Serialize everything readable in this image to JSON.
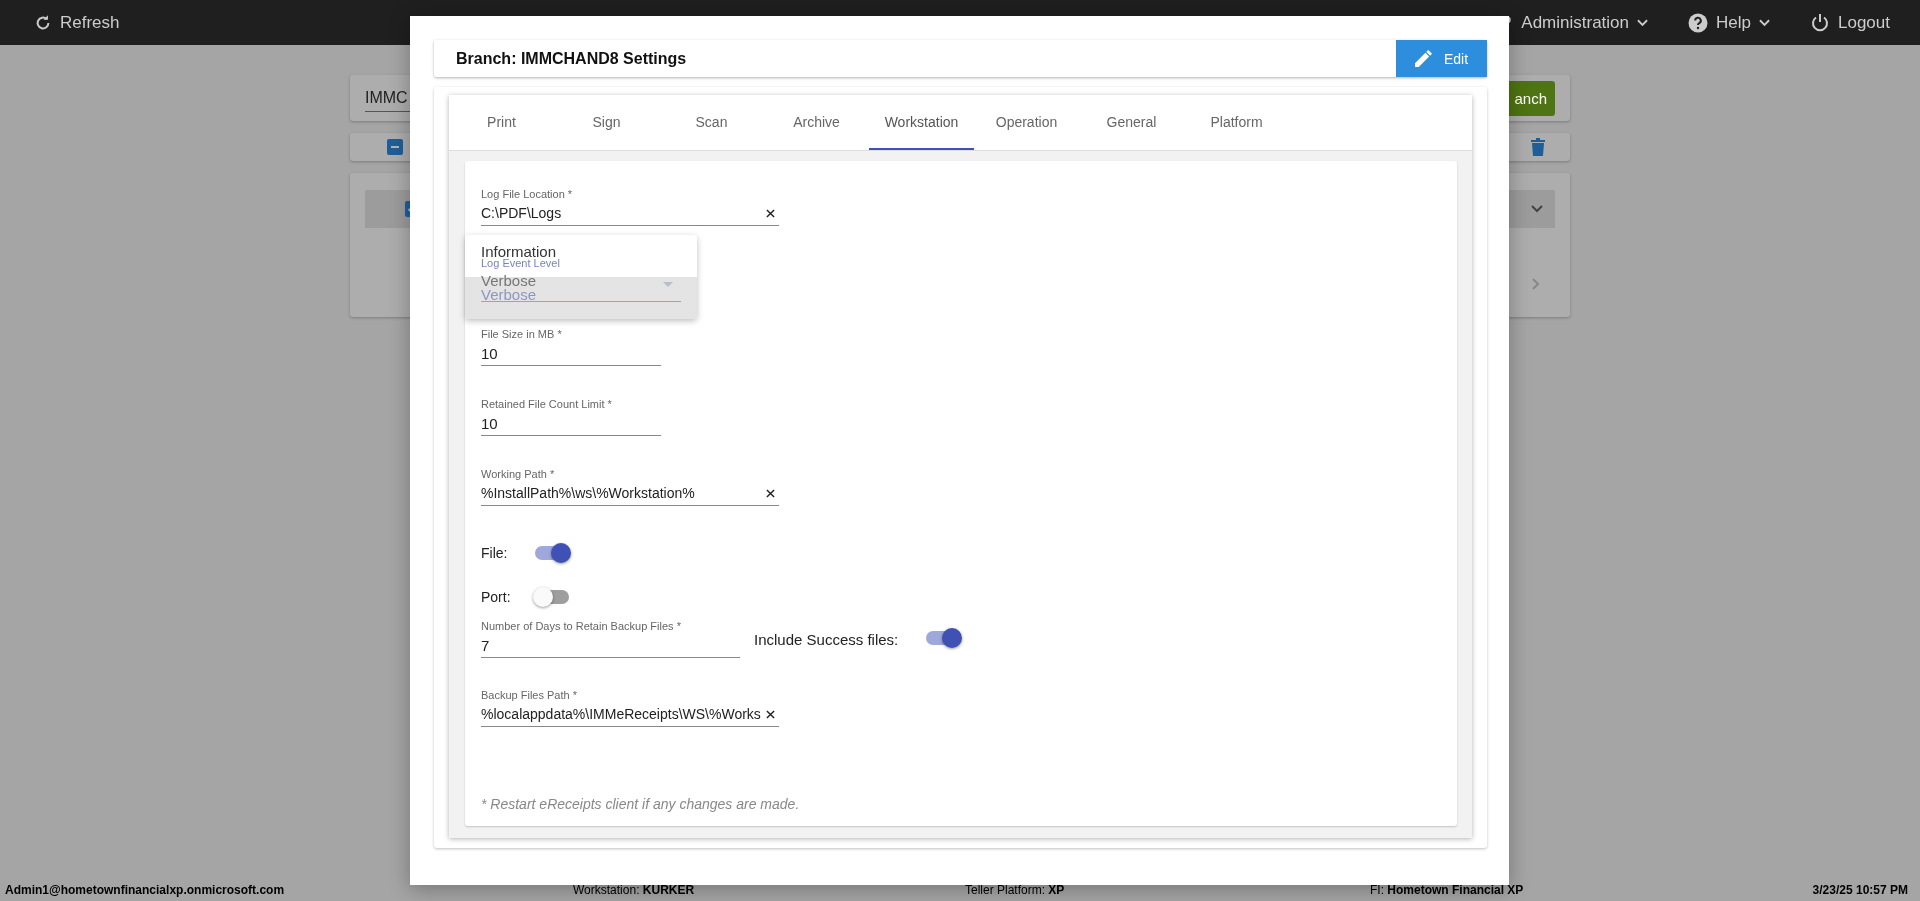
{
  "top_bar": {
    "refresh": "Refresh",
    "menus": [
      {
        "label": "Administration",
        "kind": "admin"
      },
      {
        "label": "Help",
        "kind": "help"
      }
    ],
    "logout": "Logout"
  },
  "background": {
    "search_value": "IMMC",
    "search_button": "anch",
    "item_checked": true
  },
  "dialog": {
    "title": "Branch: IMMCHAND8 Settings",
    "edit": "Edit",
    "tabs": [
      {
        "label": "Print",
        "selected": false
      },
      {
        "label": "Sign",
        "selected": false
      },
      {
        "label": "Scan",
        "selected": false
      },
      {
        "label": "Archive",
        "selected": false
      },
      {
        "label": "Workstation",
        "selected": true
      },
      {
        "label": "Operation",
        "selected": false
      },
      {
        "label": "General",
        "selected": false
      },
      {
        "label": "Platform",
        "selected": false
      }
    ],
    "fields": [
      {
        "kind": "text",
        "label": "Log File Location *",
        "value": "C:\\PDF\\Logs",
        "clearable": true
      },
      {
        "kind": "select",
        "label": "Log Event Level",
        "value": "Verbose",
        "expanded": true,
        "options": [
          {
            "label": "Information",
            "selected": false
          },
          {
            "label": "Verbose",
            "selected": true
          }
        ]
      },
      {
        "kind": "text",
        "label": "File Size in MB *",
        "value": "10",
        "clearable": false
      },
      {
        "kind": "text",
        "label": "Retained File Count Limit *",
        "value": "10",
        "clearable": false
      },
      {
        "kind": "text",
        "label": "Working Path *",
        "value": "%InstallPath%\\ws\\%Workstation%",
        "clearable": true
      },
      {
        "kind": "toggle",
        "label": "File:",
        "on": true
      },
      {
        "kind": "toggle",
        "label": "Port:",
        "on": false
      },
      {
        "kind": "text_toggle",
        "label": "Number of Days to Retain Backup Files *",
        "value": "7",
        "toggle_label": "Include Success files:",
        "on": true
      },
      {
        "kind": "text",
        "label": "Backup Files Path *",
        "value": "%localappdata%\\IMMeReceipts\\WS\\%Works",
        "clearable": true
      }
    ],
    "note": "* Restart eReceipts client if any changes are made."
  },
  "status_bar": {
    "user": "Admin1@hometownfinancialxp.onmicrosoft.com",
    "workstation": "Workstation: **KURKER**",
    "platform": "Teller Platform: **XP**",
    "fi": "FI: **Hometown Financial XP**",
    "datetime": "3/23/25 10:57 PM"
  }
}
